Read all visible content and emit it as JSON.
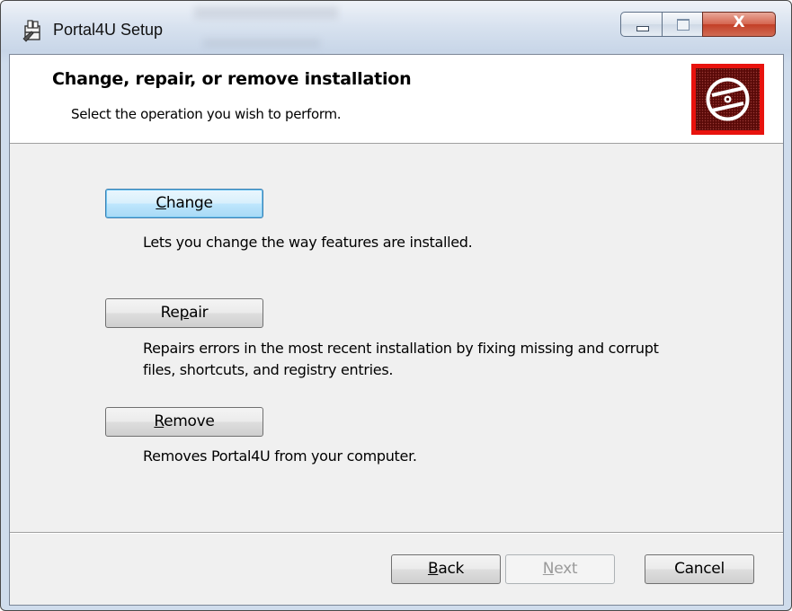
{
  "window": {
    "title": "Portal4U Setup",
    "controls": {
      "minimize": "minimize",
      "maximize": "maximize",
      "close": "X"
    }
  },
  "header": {
    "title": "Change, repair, or remove installation",
    "subtitle": "Select the operation you wish to perform.",
    "banner_icon": "disc-icon",
    "banner_color": "#e8130e"
  },
  "operations": [
    {
      "key": "change",
      "label_pre": "",
      "mnemonic": "C",
      "label_post": "hange",
      "description": "Lets you change the way features are installed."
    },
    {
      "key": "repair",
      "label_pre": "Re",
      "mnemonic": "p",
      "label_post": "air",
      "description_line1": "Repairs errors in the most recent installation by fixing missing and corrupt",
      "description_line2": "files, shortcuts, and registry entries."
    },
    {
      "key": "remove",
      "label_pre": "",
      "mnemonic": "R",
      "label_post": "emove",
      "description": "Removes Portal4U from your computer."
    }
  ],
  "footer": {
    "back": {
      "mnemonic": "B",
      "rest": "ack"
    },
    "next": {
      "mnemonic": "N",
      "rest": "ext",
      "enabled": false
    },
    "cancel": "Cancel"
  }
}
